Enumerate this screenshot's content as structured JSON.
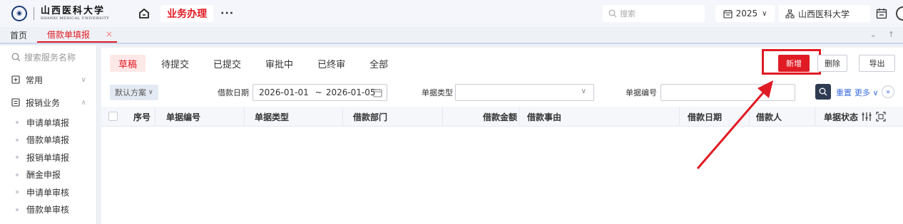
{
  "header": {
    "logo_cn": "山西医科大学",
    "logo_en": "SHANXI MEDICAL UNIVERSITY",
    "nav_active": "业务办理",
    "more": "···",
    "search_placeholder": "搜索",
    "year": "2025",
    "org": "山西医科大学"
  },
  "tabs": {
    "home": "首页",
    "active": "借款单填报",
    "close": "×"
  },
  "sidebar": {
    "search_placeholder": "搜索服务名称",
    "common": "常用",
    "group": "报销业务",
    "items": [
      "申请单填报",
      "借款单填报",
      "报销单填报",
      "酬金申报",
      "申请单审核",
      "借款单审核"
    ]
  },
  "status_tabs": [
    "草稿",
    "待提交",
    "已提交",
    "审批中",
    "已终审",
    "全部"
  ],
  "actions": {
    "add": "新增",
    "delete": "删除",
    "export": "导出"
  },
  "filters": {
    "scheme": "默认方案",
    "date_label": "借款日期",
    "date_start": "2026-01-01",
    "date_sep": "~",
    "date_end": "2026-01-05",
    "type_label": "单据类型",
    "number_label": "单据编号",
    "reset": "重置",
    "more": "更多"
  },
  "table": {
    "columns": [
      "序号",
      "单据编号",
      "单据类型",
      "借款部门",
      "借款金额",
      "借款事由",
      "借款日期",
      "借款人",
      "单据状态"
    ]
  },
  "colors": {
    "accent": "#e01b24",
    "link": "#3d6ee0"
  }
}
